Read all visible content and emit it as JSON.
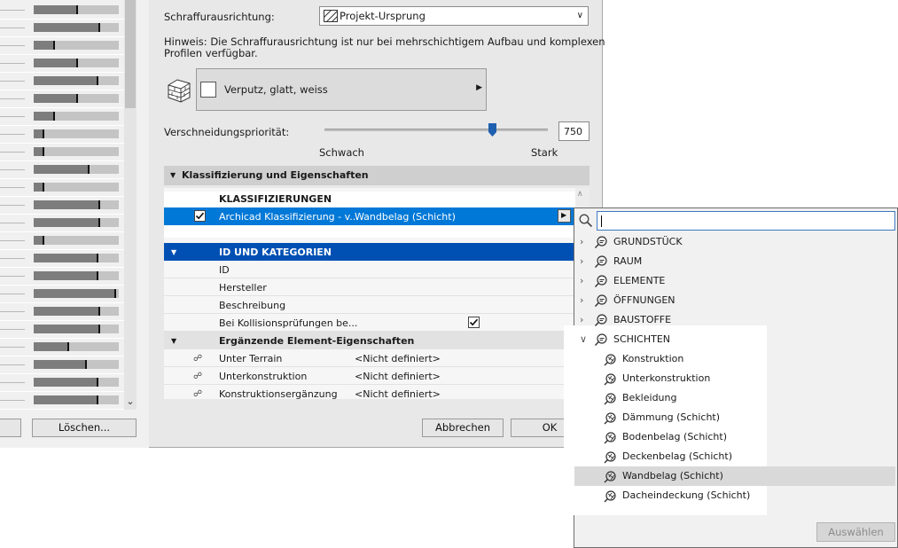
{
  "left_panel": {
    "bar_levels": [
      0.52,
      0.78,
      0.25,
      0.52,
      0.76,
      0.52,
      0.25,
      0.12,
      0.12,
      0.66,
      0.12,
      0.78,
      0.78,
      0.12,
      0.76,
      0.76,
      0.97,
      0.78,
      0.78,
      0.42,
      0.62,
      0.76,
      0.76
    ],
    "delete_button": "Löschen..."
  },
  "dialog": {
    "hatch_orientation_label": "Schraffurausrichtung:",
    "hatch_orientation_value": "Projekt-Ursprung",
    "hint_line1": "Hinweis: Die Schraffurausrichtung ist nur bei mehrschichtigem Aufbau und komplexen",
    "hint_line2": "Profilen verfügbar.",
    "surface_name": "Verputz, glatt, weiss",
    "priority_label": "Verschneidungspriorität:",
    "priority_value": "750",
    "priority_level": 0.75,
    "weak_label": "Schwach",
    "strong_label": "Stark",
    "section_title": "Klassifizierung und Eigenschaften",
    "classifications_header": "KLASSIFIZIERUNGEN",
    "class_row_system": "Archicad Klassifizierung - v...",
    "class_row_value": "Wandbelag (Schicht)",
    "id_category_header": "ID UND KATEGORIEN",
    "id_label": "ID",
    "manufacturer_label": "Hersteller",
    "description_label": "Beschreibung",
    "collision_label": "Bei Kollisionsprüfungen be...",
    "extra_props_header": "Ergänzende Element-Eigenschaften",
    "prop_rows": [
      {
        "name": "Unter Terrain",
        "value": "<Nicht definiert>"
      },
      {
        "name": "Unterkonstruktion",
        "value": "<Nicht definiert>"
      },
      {
        "name": "Konstruktionsergänzung",
        "value": "<Nicht definiert>"
      }
    ],
    "cancel_button": "Abbrechen",
    "ok_button": "OK"
  },
  "popup": {
    "search_value": "",
    "categories": [
      "GRUNDSTÜCK",
      "RAUM",
      "ELEMENTE",
      "ÖFFNUNGEN",
      "BAUSTOFFE",
      "SCHICHTEN"
    ],
    "children": [
      "Konstruktion",
      "Unterkonstruktion",
      "Bekleidung",
      "Dämmung (Schicht)",
      "Bodenbelag (Schicht)",
      "Deckenbelag (Schicht)",
      "Wandbelag (Schicht)",
      "Dacheindeckung (Schicht)"
    ],
    "selected_child": "Wandbelag (Schicht)",
    "select_button": "Auswählen"
  },
  "colors": {
    "selection_blue": "#0078d7",
    "header_blue": "#0050b4",
    "hover_gray": "#d9d9d9"
  }
}
